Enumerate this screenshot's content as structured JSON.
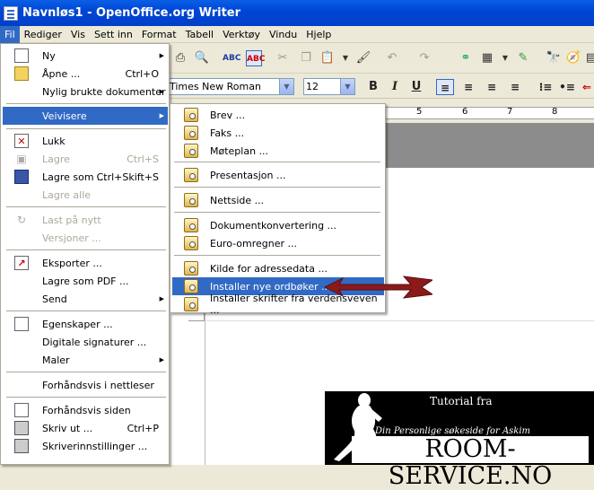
{
  "window": {
    "title": "Navnløs1 - OpenOffice.org Writer"
  },
  "menubar": [
    "Fil",
    "Rediger",
    "Vis",
    "Sett inn",
    "Format",
    "Tabell",
    "Verktøy",
    "Vindu",
    "Hjelp"
  ],
  "format_bar": {
    "font_name": "Times New Roman",
    "font_size": "12",
    "bold": "B",
    "italic": "I",
    "underline": "U"
  },
  "ruler": {
    "numbers": [
      "5",
      "6",
      "7",
      "8"
    ]
  },
  "file_menu": [
    {
      "label": "Ny",
      "arrow": "▶",
      "icon": "new-doc-icon"
    },
    {
      "label": "Åpne ...",
      "shortcut": "Ctrl+O",
      "icon": "open-folder-icon"
    },
    {
      "label": "Nylig brukte dokumenter",
      "arrow": "▶"
    },
    {
      "label": "Veivisere",
      "arrow": "▶",
      "highlight": true
    },
    {
      "label": "Lukk",
      "icon": "close-doc-icon"
    },
    {
      "label": "Lagre",
      "shortcut": "Ctrl+S",
      "disabled": true,
      "icon": "save-icon"
    },
    {
      "label": "Lagre som ...",
      "shortcut": "Ctrl+Skift+S",
      "icon": "save-as-icon"
    },
    {
      "label": "Lagre alle",
      "disabled": true
    },
    {
      "label": "Last på nytt",
      "disabled": true,
      "icon": "reload-icon"
    },
    {
      "label": "Versjoner ...",
      "disabled": true
    },
    {
      "label": "Eksporter ...",
      "icon": "export-icon"
    },
    {
      "label": "Lagre som PDF ..."
    },
    {
      "label": "Send",
      "arrow": "▶"
    },
    {
      "label": "Egenskaper ...",
      "icon": "properties-icon"
    },
    {
      "label": "Digitale signaturer ..."
    },
    {
      "label": "Maler",
      "arrow": "▶"
    },
    {
      "label": "Forhåndsvis i nettleser"
    },
    {
      "label": "Forhåndsvis siden",
      "icon": "page-preview-icon"
    },
    {
      "label": "Skriv ut ...",
      "shortcut": "Ctrl+P",
      "icon": "print-icon"
    },
    {
      "label": "Skriverinnstillinger ...",
      "icon": "printer-settings-icon"
    }
  ],
  "wizard_menu": [
    {
      "label": "Brev ..."
    },
    {
      "label": "Faks ..."
    },
    {
      "label": "Møteplan ..."
    },
    {
      "label": "Presentasjon ..."
    },
    {
      "label": "Nettside ..."
    },
    {
      "label": "Dokumentkonvertering ..."
    },
    {
      "label": "Euro-omregner ..."
    },
    {
      "label": "Kilde for adressedata ..."
    },
    {
      "label": "Installer nye ordbøker ...",
      "highlight": true
    },
    {
      "label": "Installer skrifter fra verdensveven ..."
    }
  ],
  "banner": {
    "line1": "Tutorial fra",
    "line2": "Din Personlige søkeside for Askim",
    "line3": "ROOM-SERVICE.NO"
  },
  "colors": {
    "highlight": "#316ac5",
    "titlebar": "#0046d5",
    "arrow": "#8b1a1a"
  }
}
